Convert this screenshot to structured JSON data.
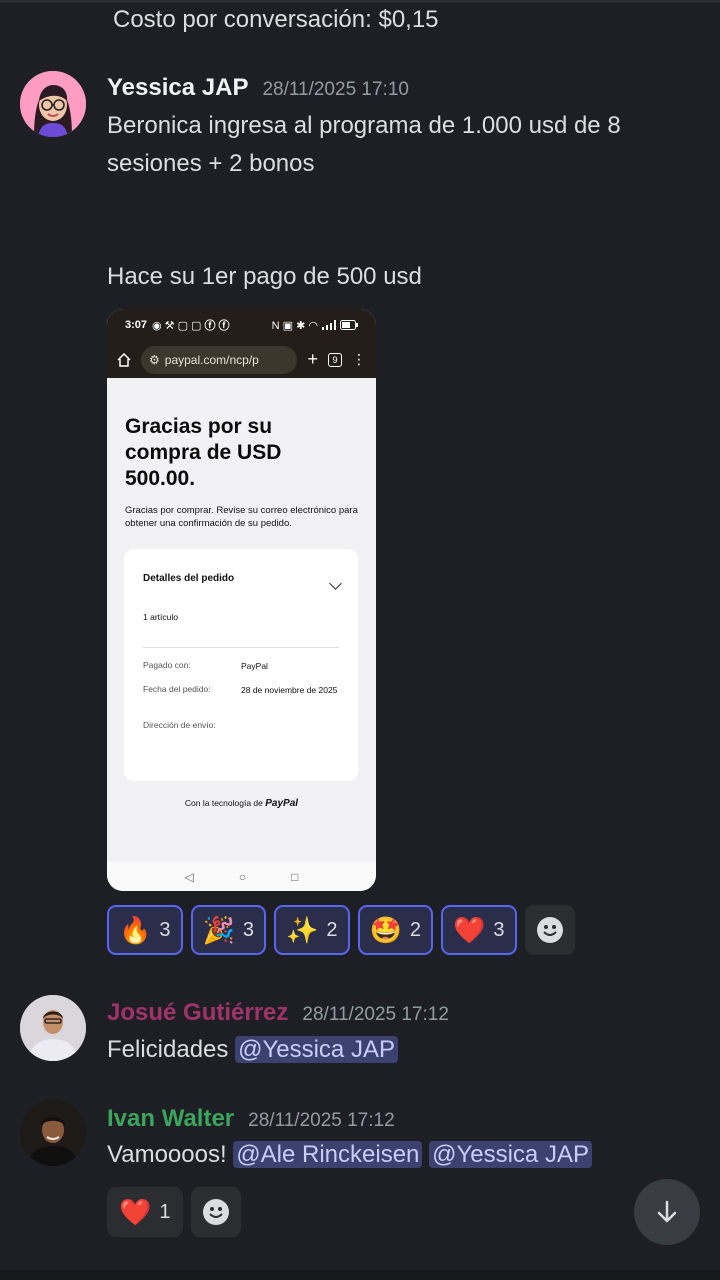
{
  "previous_message": {
    "text": "Costo por conversación: $0,15"
  },
  "messages": [
    {
      "author": "Yessica JAP",
      "author_color": "#f2f3f5",
      "timestamp": "28/11/2025 17:10",
      "line1": "Beronica ingresa al programa de 1.000 usd de 8",
      "line2": "sesiones + 2 bonos",
      "line3": "Hace su 1er pago de 500 usd",
      "attachment": {
        "status_time": "3:07",
        "url": "paypal.com/ncp/p",
        "tabs_count": "9",
        "title": "Gracias por su compra de USD 500.00.",
        "description": "Gracias por comprar. Revise su correo electrónico para obtener una confirmación de su pedido.",
        "details_title": "Detalles del pedido",
        "items_count": "1 artículo",
        "paid_with_label": "Pagado con:",
        "paid_with_value": "PayPal",
        "order_date_label": "Fecha del pedido:",
        "order_date_value": "28 de noviembre de 2025",
        "shipping_label": "Dirección de envío:",
        "footer_text": "Con la tecnología de",
        "footer_brand": "PayPal"
      },
      "reactions": [
        {
          "emoji": "🔥",
          "count": "3"
        },
        {
          "emoji": "🎉",
          "count": "3"
        },
        {
          "emoji": "✨",
          "count": "2"
        },
        {
          "emoji": "🤩",
          "count": "2"
        },
        {
          "emoji": "❤️",
          "count": "3"
        }
      ]
    },
    {
      "author": "Josué Gutiérrez",
      "author_color": "#a0336a",
      "timestamp": "28/11/2025 17:12",
      "text": "Felicidades",
      "mention": "@Yessica JAP"
    },
    {
      "author": "Ivan Walter",
      "author_color": "#3ba55c",
      "timestamp": "28/11/2025 17:12",
      "text": "Vamoooos!",
      "mention1": "@Ale Rinckeisen",
      "mention2": "@Yessica JAP",
      "reactions": [
        {
          "emoji": "❤️",
          "count": "1"
        }
      ]
    }
  ]
}
